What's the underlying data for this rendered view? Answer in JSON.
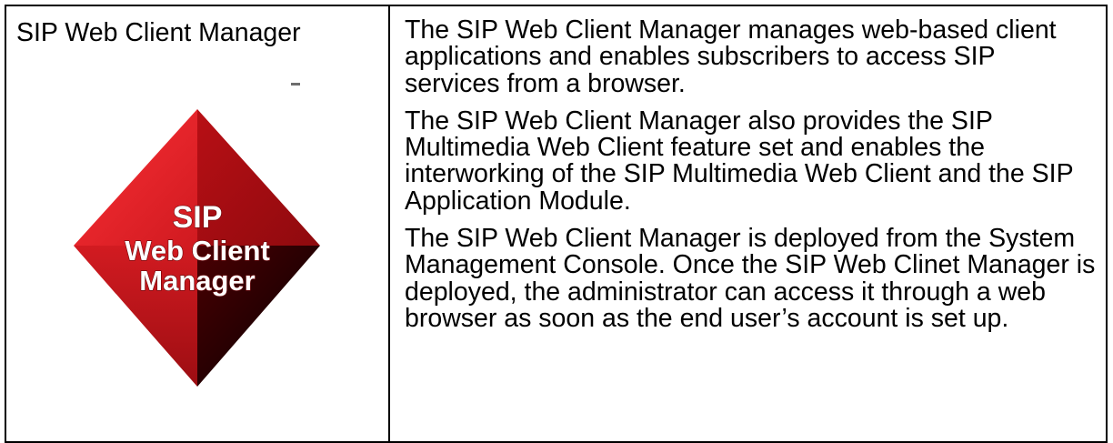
{
  "component": {
    "name": "SIP Web Client Manager",
    "logo_lines": [
      "SIP",
      "Web Client",
      "Manager"
    ],
    "logo_colors": {
      "bright_red": "#e8262c",
      "mid_red": "#c6141a",
      "dark_red": "#8f0a0e",
      "shadow": "#1a0000",
      "text": "#ffffff"
    }
  },
  "description": {
    "paragraphs": [
      "The SIP Web Client Manager manages web-based client applications and enables subscribers to access SIP services from a browser.",
      "The SIP Web Client Manager also provides the SIP Multimedia Web Client feature set and enables the interworking of the SIP Multimedia Web Client and the SIP Application Module.",
      "The SIP Web Client Manager is deployed from the System Management Console. Once the SIP Web Clinet Manager is deployed, the administrator can access it through a web browser as soon as the end user’s account is set up."
    ]
  }
}
